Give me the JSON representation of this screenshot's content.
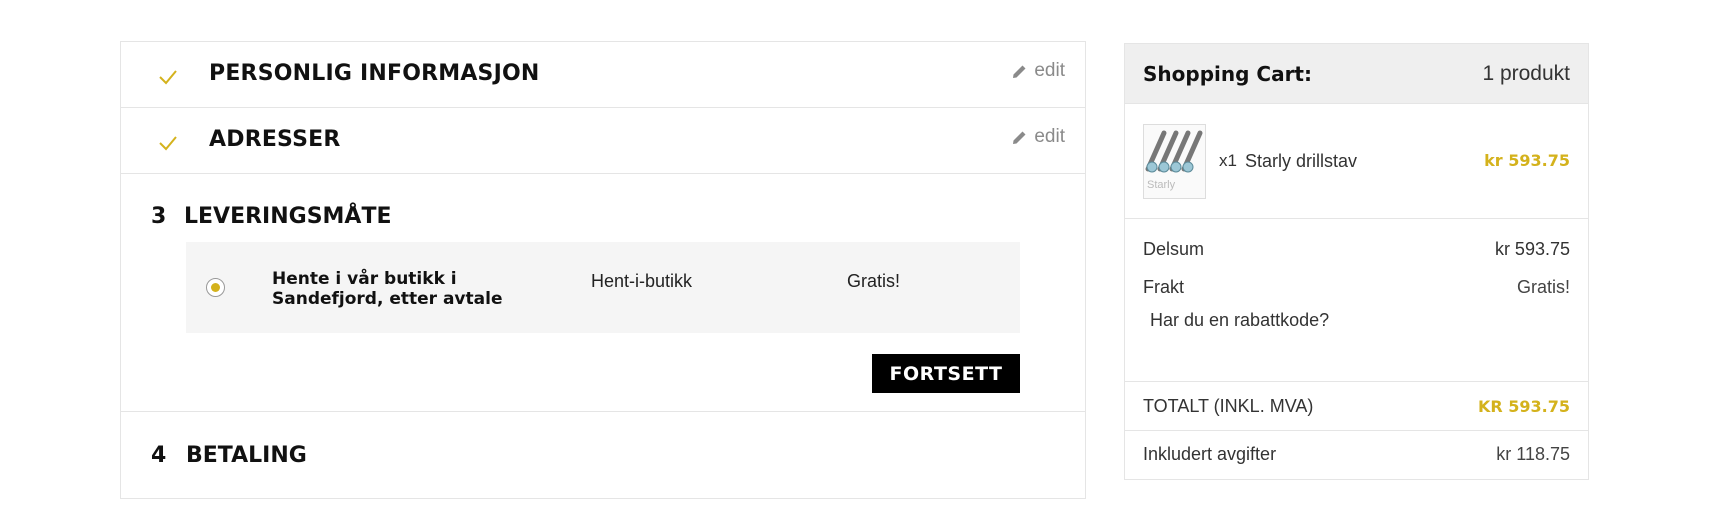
{
  "colors": {
    "accent": "#d4b21c",
    "button_bg": "#000000",
    "border": "#e5e5e5",
    "panel_bg": "#f5f5f5",
    "header_bg": "#efefef"
  },
  "checkout": {
    "steps_done": [
      {
        "title": "PERSONLIG INFORMASJON",
        "edit_label": "edit",
        "icon": "check-icon"
      },
      {
        "title": "ADRESSER",
        "edit_label": "edit",
        "icon": "check-icon"
      }
    ],
    "current_step": {
      "number": "3",
      "title": "LEVERINGSMÅTE",
      "carrier": {
        "name": "Hente i vår butikk i Sandefjord, etter avtale",
        "delay": "Hent-i-butikk",
        "price": "Gratis!",
        "selected": true
      },
      "continue_label": "FORTSETT"
    },
    "next_step": {
      "number": "4",
      "title": "BETALING"
    }
  },
  "cart": {
    "title": "Shopping Cart:",
    "count": "1 produkt",
    "items": [
      {
        "qty": "x1",
        "name": "Starly drillstav",
        "price": "kr 593.75",
        "thumb_watermark": "Starly"
      }
    ],
    "subtotal_label": "Delsum",
    "subtotal_value": "kr 593.75",
    "shipping_label": "Frakt",
    "shipping_value": "Gratis!",
    "promo_label": "Har du en rabattkode?",
    "total_label": "TOTALT (INKL. MVA)",
    "total_value": "KR 593.75",
    "taxes_label": "Inkludert avgifter",
    "taxes_value": "kr 118.75"
  }
}
